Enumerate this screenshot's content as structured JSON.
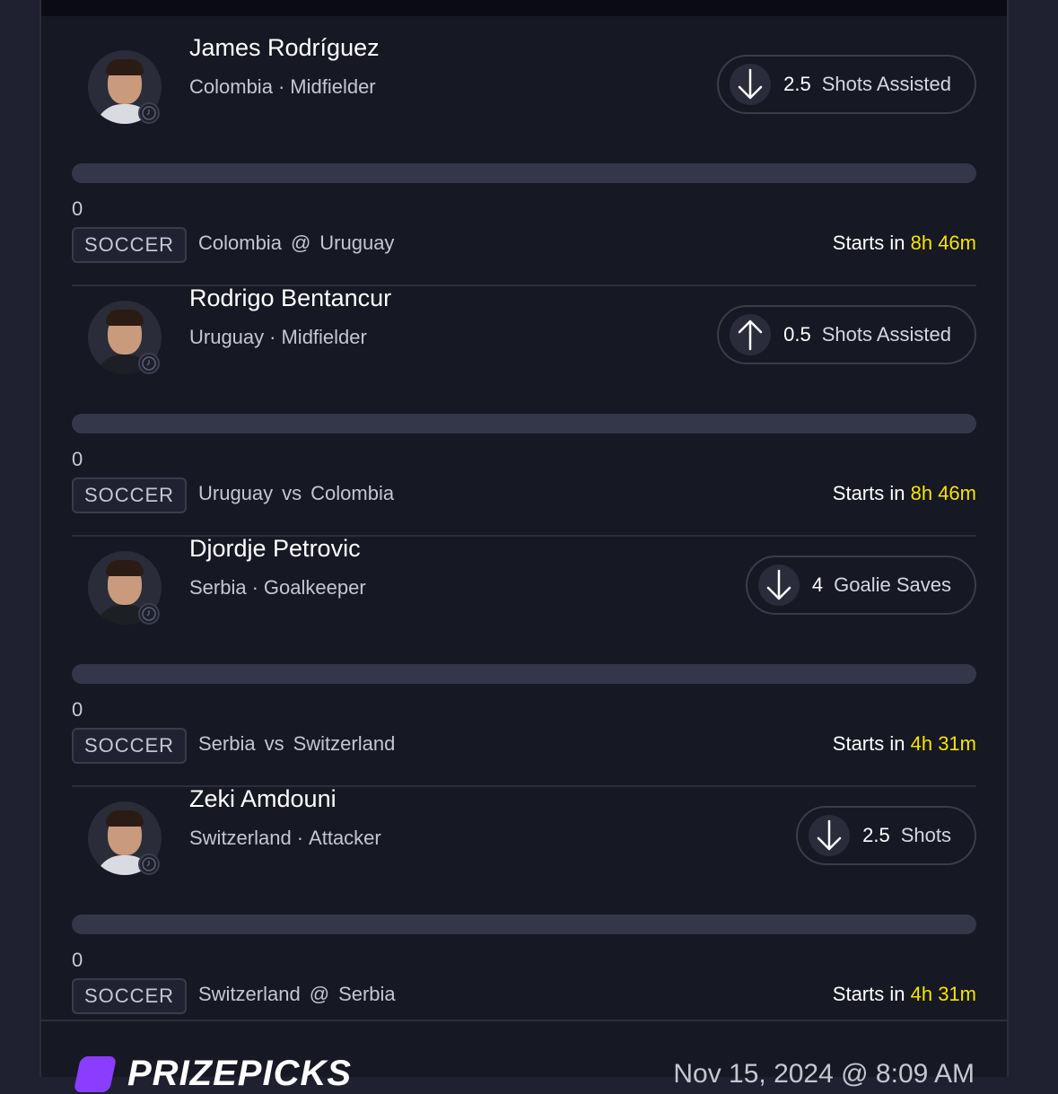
{
  "picks": [
    {
      "player": "James Rodríguez",
      "team": "Colombia",
      "position": "Midfielder",
      "direction": "down",
      "line": "2.5",
      "stat": "Shots Assisted",
      "progress": 0,
      "score": "0",
      "league": "SOCCER",
      "home": "Colombia",
      "sep": "@",
      "away": "Uruguay",
      "starts_label": "Starts in",
      "starts_time": "8h 46m"
    },
    {
      "player": "Rodrigo Bentancur",
      "team": "Uruguay",
      "position": "Midfielder",
      "direction": "up",
      "line": "0.5",
      "stat": "Shots Assisted",
      "progress": 0,
      "score": "0",
      "league": "SOCCER",
      "home": "Uruguay",
      "sep": "vs",
      "away": "Colombia",
      "starts_label": "Starts in",
      "starts_time": "8h 46m"
    },
    {
      "player": "Djordje Petrovic",
      "team": "Serbia",
      "position": "Goalkeeper",
      "direction": "down",
      "line": "4",
      "stat": "Goalie Saves",
      "progress": 0,
      "score": "0",
      "league": "SOCCER",
      "home": "Serbia",
      "sep": "vs",
      "away": "Switzerland",
      "starts_label": "Starts in",
      "starts_time": "4h 31m"
    },
    {
      "player": "Zeki Amdouni",
      "team": "Switzerland",
      "position": "Attacker",
      "direction": "down",
      "line": "2.5",
      "stat": "Shots",
      "progress": 0,
      "score": "0",
      "league": "SOCCER",
      "home": "Switzerland",
      "sep": "@",
      "away": "Serbia",
      "starts_label": "Starts in",
      "starts_time": "4h 31m"
    }
  ],
  "footer": {
    "brand": "PRIZEPICKS",
    "timestamp": "Nov 15, 2024 @ 8:09 AM"
  },
  "colors": {
    "accent_time": "#f7e300",
    "brand": "#8b3dff"
  },
  "icons": {
    "down": "arrow-down-icon",
    "up": "arrow-up-icon",
    "clock": "clock-icon"
  }
}
